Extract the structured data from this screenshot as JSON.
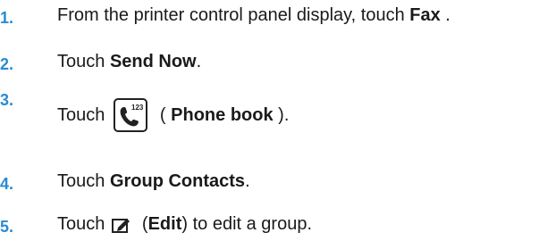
{
  "steps": [
    {
      "num": "1.",
      "pre": "From the printer control panel display, touch ",
      "bold": "Fax",
      "post": " ."
    },
    {
      "num": "2.",
      "pre": "Touch ",
      "bold": "Send Now",
      "post": "."
    },
    {
      "num": "3.",
      "pre": "Touch",
      "icon": "phone-book-icon",
      "icon_text": "123",
      "mid": " ( ",
      "bold": "Phone book",
      "post": " )."
    },
    {
      "num": "4.",
      "pre": "Touch ",
      "bold": "Group Contacts",
      "post": "."
    },
    {
      "num": "5.",
      "pre": "Touch",
      "icon": "edit-icon",
      "mid": " (",
      "bold": "Edit",
      "post": ") to edit a group."
    }
  ],
  "colors": {
    "step_number": "#2a8bd0",
    "text": "#1a1a1a"
  }
}
